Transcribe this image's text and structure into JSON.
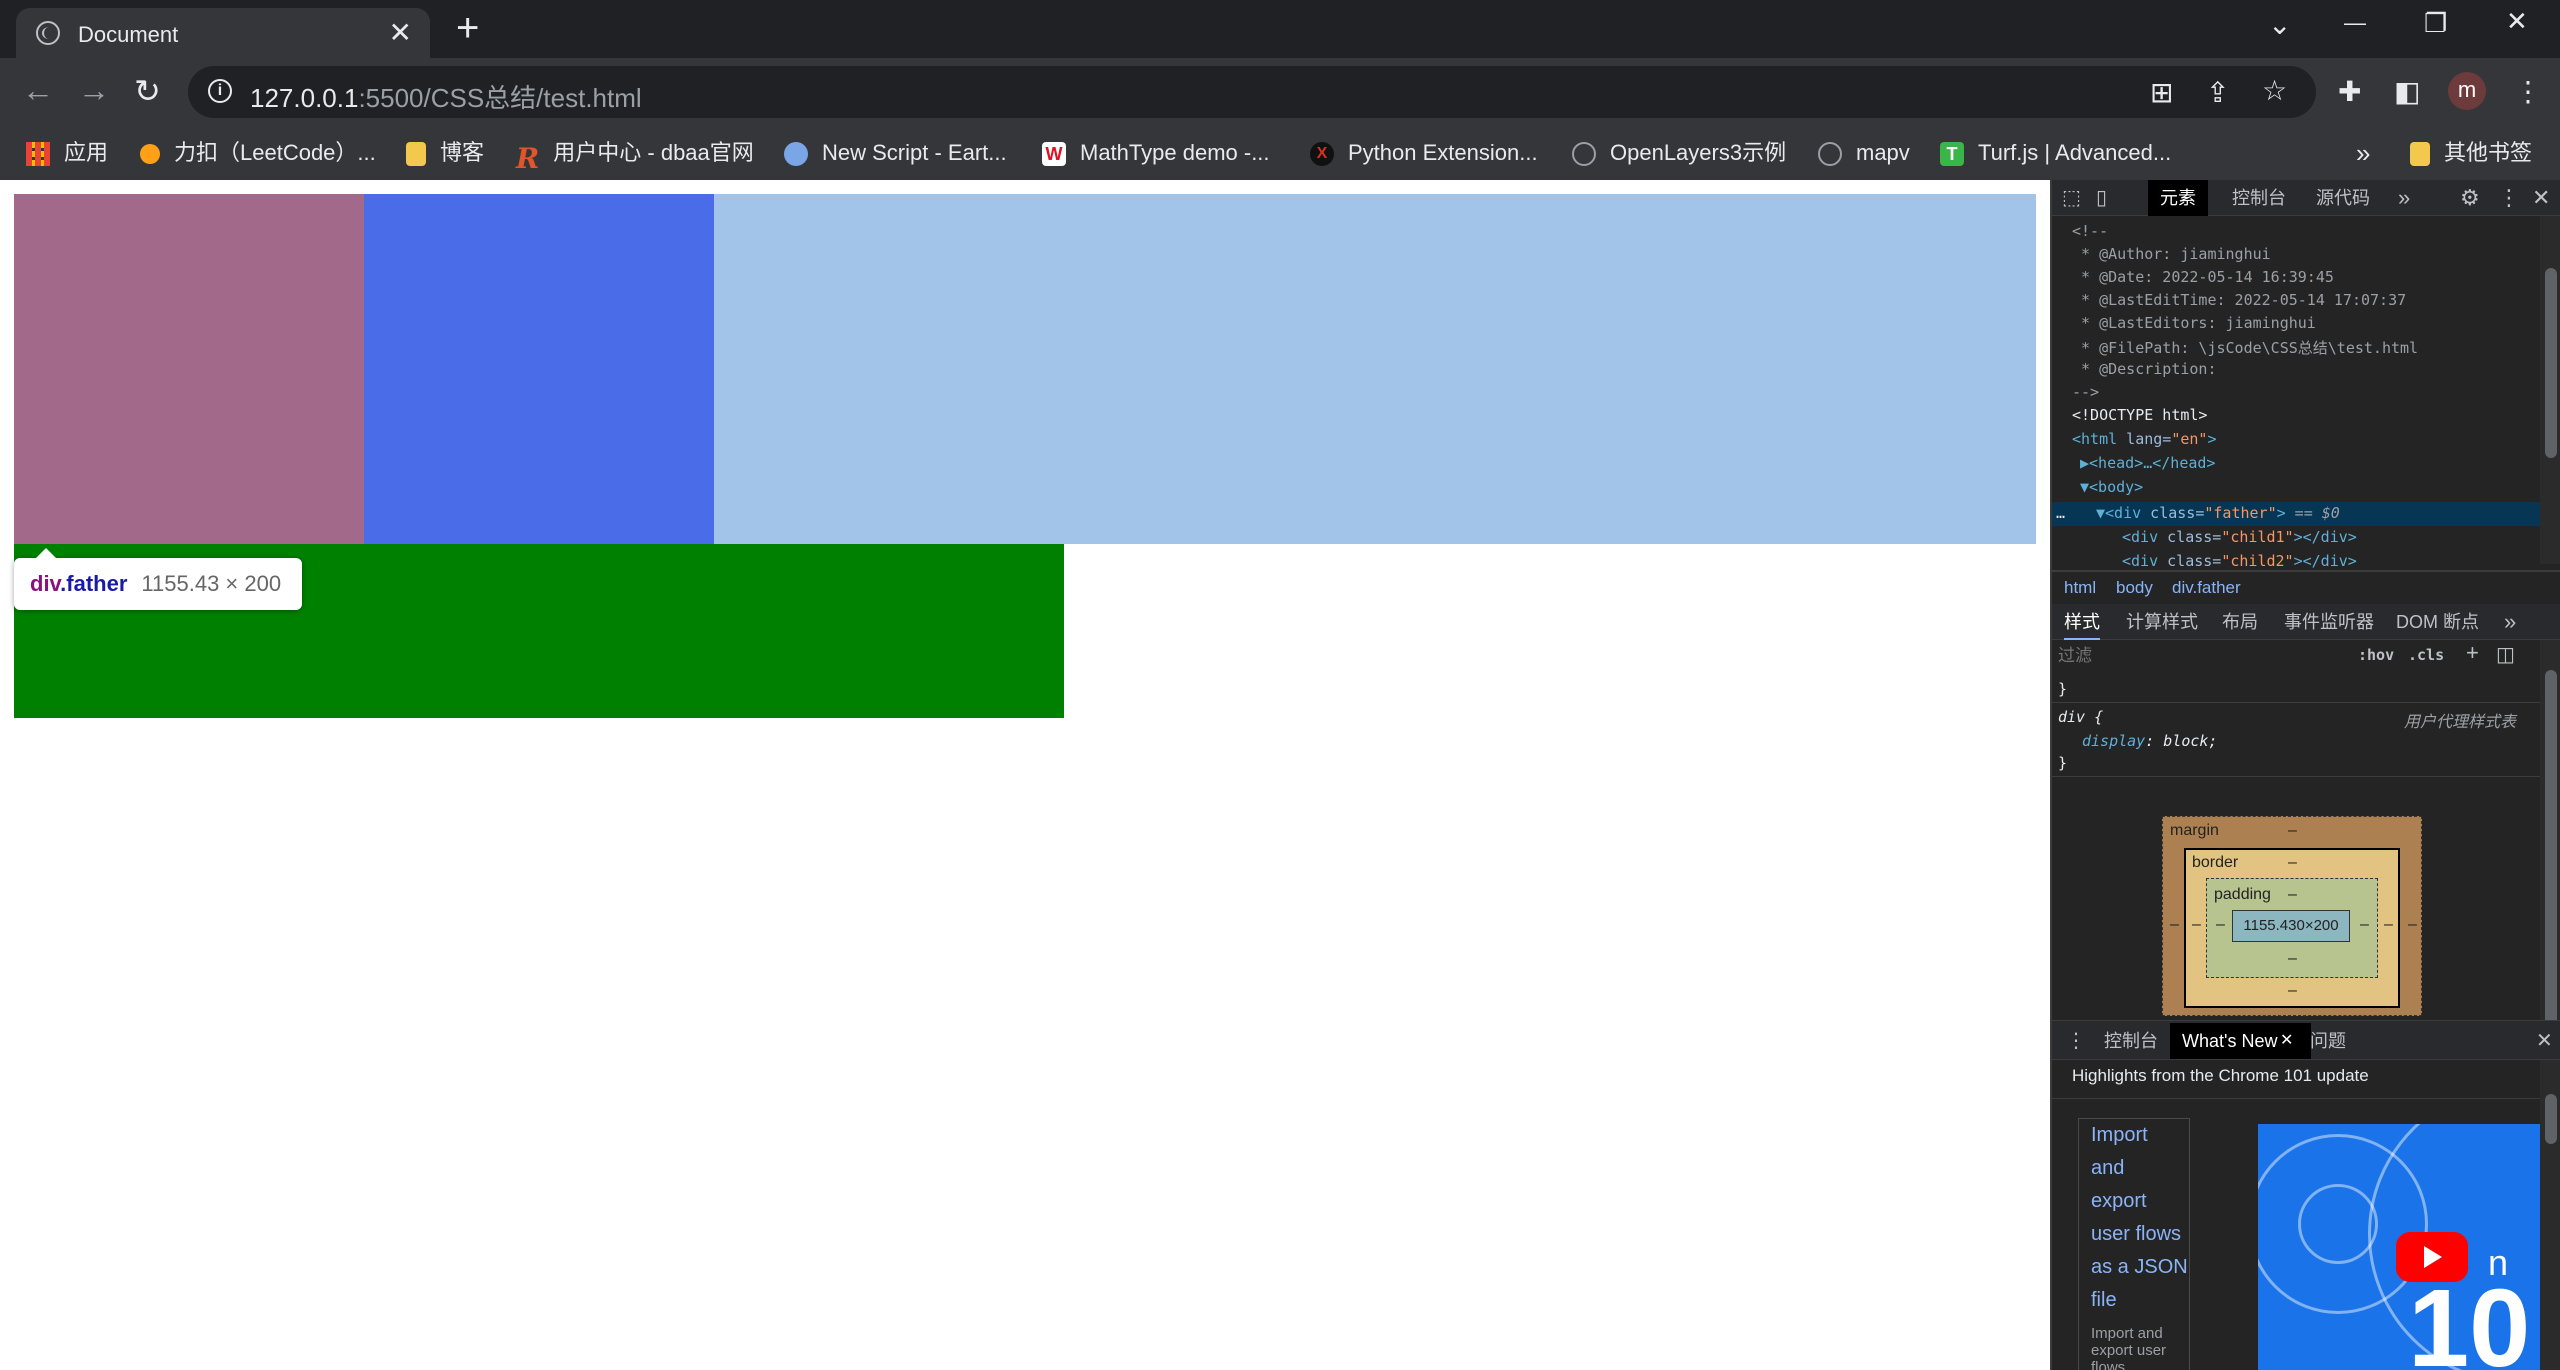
{
  "tab": {
    "title": "Document",
    "close": "✕",
    "new_tab": "+"
  },
  "window_controls": {
    "minimize": "—",
    "restore": "❐",
    "close": "✕",
    "tab_search": "⌄"
  },
  "address": {
    "host": "127.0.0.1",
    "path": ":5500/CSS总结/test.html"
  },
  "profile": {
    "initial": "m"
  },
  "bookmarks": [
    {
      "label": "应用",
      "icon": "apps-grid-icon",
      "color": "#ea4335"
    },
    {
      "label": "力扣（LeetCode）...",
      "icon": "leetcode-icon",
      "color": "#ffa116"
    },
    {
      "label": "博客",
      "icon": "folder-icon",
      "color": "#f2c94c"
    },
    {
      "label": "用户中心 - dbaa官网",
      "icon": "r-logo-icon",
      "color": "#e2542a"
    },
    {
      "label": "New Script - Eart...",
      "icon": "earth-engine-icon",
      "color": "#7aa6e8"
    },
    {
      "label": "MathType demo -...",
      "icon": "mathtype-icon",
      "color": "#ffffff"
    },
    {
      "label": "Python Extension...",
      "icon": "python-ext-icon",
      "color": "#d93025"
    },
    {
      "label": "OpenLayers3示例",
      "icon": "globe-icon",
      "color": "#9aa0a6"
    },
    {
      "label": "mapv",
      "icon": "globe-icon",
      "color": "#9aa0a6"
    },
    {
      "label": "Turf.js | Advanced...",
      "icon": "turf-icon",
      "color": "#3bb54a"
    }
  ],
  "bookmarks_more": "»",
  "other_bookmarks": "其他书签",
  "page": {
    "boxes": [
      {
        "name": "child1",
        "color": "#a2698b"
      },
      {
        "name": "child2",
        "color": "#4a6ce8"
      },
      {
        "name": "child3",
        "color": "#a1c4e8"
      },
      {
        "name": "green-box",
        "color": "#008000"
      }
    ],
    "tooltip": {
      "tag": "div",
      "cls": ".father",
      "dims": "1155.43 × 200"
    }
  },
  "devtools": {
    "tabs": {
      "elements": "元素",
      "console": "控制台",
      "sources": "源代码",
      "more": "»"
    },
    "code_lines": [
      "<!--",
      " * @Author: jiaminghui",
      " * @Date: 2022-05-14 16:39:45",
      " * @LastEditTime: 2022-05-14 17:07:37",
      " * @LastEditors: jiaminghui",
      " * @FilePath: \\jsCode\\CSS总结\\test.html",
      " * @Description:",
      "-->"
    ],
    "doctype": "<!DOCTYPE html>",
    "html_tag": {
      "open": "<html",
      "attr": " lang=",
      "val": "\"en\"",
      "close": ">"
    },
    "head": "▶<head>…</head>",
    "body": "▼<body>",
    "selected": {
      "prefix": "▼<div",
      "attr": " class=",
      "val": "\"father\"",
      "close": ">",
      "eq": " == $0",
      "dots": "…"
    },
    "child1": {
      "open": "<div",
      "attr": " class=",
      "val": "\"child1\"",
      "close": "></div>"
    },
    "child2": {
      "open": "<div",
      "attr": " class=",
      "val": "\"child2\"",
      "close": "></div>"
    },
    "breadcrumbs": [
      "html",
      "body",
      "div.father"
    ],
    "style_tabs": {
      "styles": "样式",
      "computed": "计算样式",
      "layout": "布局",
      "listeners": "事件监听器",
      "dom_breakpoints": "DOM 断点",
      "more": "»"
    },
    "filter": {
      "placeholder": "过滤",
      "hov": ":hov",
      "cls": ".cls",
      "plus": "+"
    },
    "css": {
      "close_brace": "}",
      "selector": "div {",
      "origin": "用户代理样式表",
      "prop": "display",
      "value": "block;",
      "end": "}"
    },
    "boxmodel": {
      "margin": "margin",
      "border": "border",
      "padding": "padding",
      "dash": "–",
      "content": "1155.430×200"
    },
    "drawer": {
      "tabs": {
        "console": "控制台",
        "whatsnew": "What's New",
        "issues": "问题"
      },
      "highlights": "Highlights from the Chrome 101 update",
      "card_lines": [
        "Import",
        "and",
        "export",
        "user flows",
        "as a JSON",
        "file"
      ],
      "card_sub": "Import and export user flows",
      "thumb_text": "10",
      "thumb_suffix": "n"
    }
  }
}
